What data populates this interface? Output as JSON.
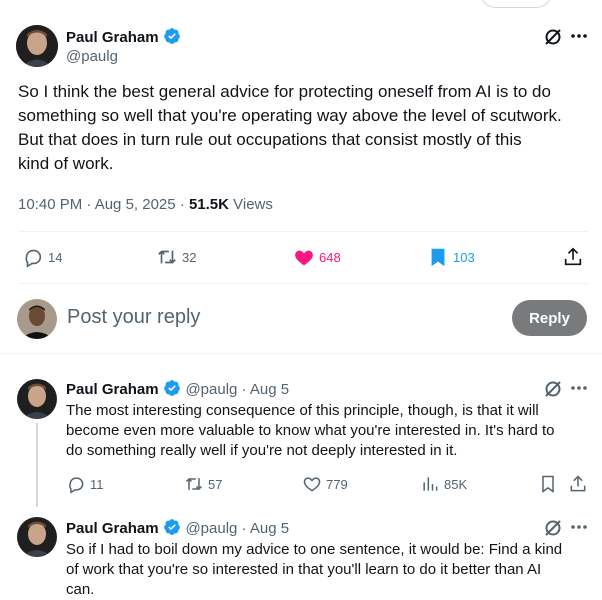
{
  "main_tweet": {
    "author_name": "Paul Graham",
    "author_handle": "@paulg",
    "text_lines": [
      "So I think the best general advice for protecting oneself from AI is to do",
      "something so well that you're operating way above the level of scutwork.",
      "But that does in turn rule out occupations that consist mostly of this",
      "kind of work."
    ],
    "timestamp": "10:40 PM · Aug 5, 2025 · ",
    "views_count": "51.5K",
    "views_label": " Views",
    "actions": {
      "replies": "14",
      "reposts": "32",
      "likes": "648",
      "bookmarks": "103"
    }
  },
  "composer": {
    "placeholder": "Post your reply",
    "reply_button": "Reply"
  },
  "replies": [
    {
      "author_name": "Paul Graham",
      "meta": "@paulg · Aug 5",
      "text_lines": [
        "The most interesting consequence of this principle, though, is that it will",
        "become even more valuable to know what you're interested in. It's hard to",
        "do something really well if you're not deeply interested in it."
      ],
      "actions": {
        "replies": "11",
        "reposts": "57",
        "likes": "779",
        "views": "85K"
      }
    },
    {
      "author_name": "Paul Graham",
      "meta": "@paulg · Aug 5",
      "text_lines": [
        "So if I had to boil down my advice to one sentence, it would be: Find a kind",
        "of work that you're so interested in that you'll learn to do it better than AI",
        "can."
      ]
    }
  ],
  "colors": {
    "like_active": "#f91880",
    "bookmark_active": "#1d9bf0",
    "verified": "#1d9bf0",
    "secondary_text": "#536471"
  }
}
